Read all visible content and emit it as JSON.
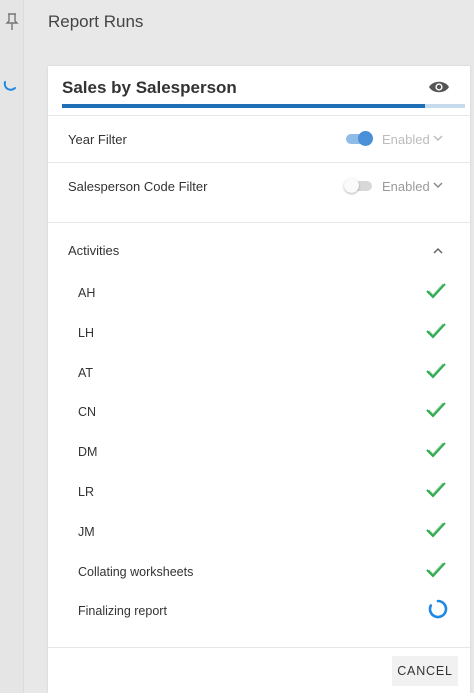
{
  "header": {
    "title": "Report Runs"
  },
  "card": {
    "title": "Sales by Salesperson",
    "progress": 0.9
  },
  "filters": [
    {
      "label": "Year Filter",
      "enabled": true,
      "state_text": "Enabled"
    },
    {
      "label": "Salesperson Code Filter",
      "enabled": false,
      "state_text": "Enabled"
    }
  ],
  "activities": {
    "label": "Activities",
    "items": [
      {
        "label": "AH",
        "status": "done"
      },
      {
        "label": "LH",
        "status": "done"
      },
      {
        "label": "AT",
        "status": "done"
      },
      {
        "label": "CN",
        "status": "done"
      },
      {
        "label": "DM",
        "status": "done"
      },
      {
        "label": "LR",
        "status": "done"
      },
      {
        "label": "JM",
        "status": "done"
      },
      {
        "label": "Collating worksheets",
        "status": "done"
      },
      {
        "label": "Finalizing report",
        "status": "loading"
      }
    ]
  },
  "footer": {
    "cancel_label": "CANCEL"
  },
  "icons": {
    "pin": "pin-icon",
    "eye": "eye-icon",
    "check": "check-icon",
    "loading": "loading-spinner-icon",
    "chevron_down": "chevron-down-icon",
    "chevron_up": "chevron-up-icon"
  },
  "colors": {
    "accent": "#1f6fb7",
    "progress_track": "#c7dbef",
    "check_green": "#2eaa4f",
    "spinner_blue": "#1e88e5"
  }
}
